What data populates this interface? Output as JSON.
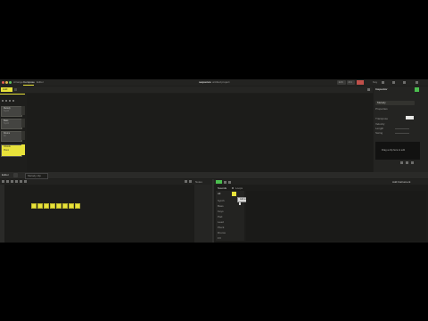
{
  "window": {
    "mode_tabs": [
      "Arrange",
      "Compose",
      "Editor"
    ],
    "title": "sequence",
    "subtitle": "untitled project",
    "tempo": "120",
    "time_sig": "4/4",
    "key_label": "Key"
  },
  "arrange": {
    "add_button": "Add",
    "clips": [
      {
        "name": "Melody",
        "sub": "Synth"
      },
      {
        "name": "Bass",
        "sub": "Synth"
      },
      {
        "name": "Drums",
        "sub": "Kit"
      },
      {
        "name": "Chords",
        "sub": "Piano"
      }
    ]
  },
  "inspector": {
    "title": "Inspector",
    "field_name": "Melody",
    "sections": [
      "Properties",
      "Transpose",
      "Velocity",
      "Length",
      "Swing"
    ],
    "preview_text": "Drag a clip here to edit"
  },
  "editor": {
    "tab_label": "Editor",
    "clip_label": "Melody clip",
    "section_header": "Notes",
    "note_count": 8
  },
  "browser": {
    "tabs": [
      "Sounds",
      "Loops"
    ],
    "filter": "All",
    "items": [
      "Synth",
      "Bass",
      "Keys",
      "Pad",
      "Lead",
      "Pluck",
      "Drums",
      "FX"
    ],
    "popup_label": "Add sound",
    "right_label": "Add Instrument"
  },
  "colors": {
    "accent": "#e8e23a",
    "background": "#1e1e1c",
    "panel": "#2a2a28",
    "green": "#4bbf4f"
  }
}
